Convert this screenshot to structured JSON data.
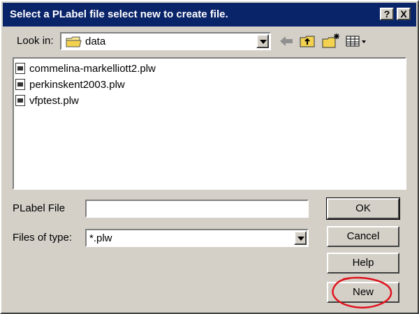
{
  "window": {
    "title": "Select a PLabel file select new to create file."
  },
  "titlebar": {
    "help_glyph": "?",
    "close_glyph": "X"
  },
  "lookin": {
    "label": "Look in:",
    "folder": "data"
  },
  "files": [
    {
      "name": "commelina-markelliott2.plw"
    },
    {
      "name": "perkinskent2003.plw"
    },
    {
      "name": "vfptest.plw"
    }
  ],
  "plabel": {
    "label": "PLabel File",
    "value": ""
  },
  "filetype": {
    "label": "Files of type:",
    "value": "*.plw"
  },
  "buttons": {
    "ok": "OK",
    "cancel": "Cancel",
    "help": "Help",
    "new": "New"
  },
  "colors": {
    "titlebar": "#0a246a",
    "face": "#d4d0c8",
    "highlight_ellipse": "#e0121d"
  },
  "icons": [
    "back-arrow-icon",
    "up-folder-icon",
    "new-folder-icon",
    "view-menu-icon",
    "folder-icon",
    "plw-file-icon"
  ]
}
